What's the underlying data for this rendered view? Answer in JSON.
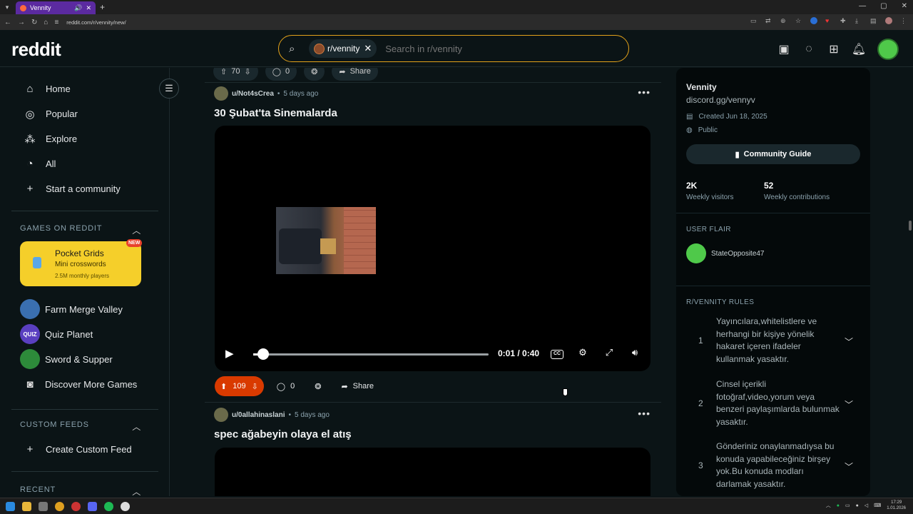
{
  "browser": {
    "tab_title": "Vennity",
    "url": "reddit.com/r/vennity/new/"
  },
  "header": {
    "logo": "reddit",
    "search_chip": "r/vennity",
    "search_placeholder": "Search in r/vennity"
  },
  "left_nav": {
    "items": [
      {
        "label": "Home",
        "icon": "home-icon"
      },
      {
        "label": "Popular",
        "icon": "popular-icon"
      },
      {
        "label": "Explore",
        "icon": "explore-icon"
      },
      {
        "label": "All",
        "icon": "all-icon"
      },
      {
        "label": "Start a community",
        "icon": "plus-icon"
      }
    ],
    "games_heading": "GAMES ON REDDIT",
    "promo": {
      "title": "Pocket Grids",
      "subtitle": "Mini crosswords",
      "meta": "2.5M monthly players",
      "badge": "NEW"
    },
    "games": [
      {
        "label": "Farm Merge Valley",
        "color": "#3a6fb0"
      },
      {
        "label": "Quiz Planet",
        "color": "#5a3fc0",
        "avatar_text": "QUIZ"
      },
      {
        "label": "Sword & Supper",
        "color": "#2d8a3a"
      },
      {
        "label": "Discover More Games"
      }
    ],
    "custom_feeds_heading": "CUSTOM FEEDS",
    "create_feed": "Create Custom Feed",
    "recent_heading": "RECENT"
  },
  "feed": {
    "prev_post": {
      "votes": "70",
      "comments": "0",
      "share": "Share"
    },
    "posts": [
      {
        "user": "u/Not4sCrea",
        "time": "5 days ago",
        "title": "30 Şubat'ta Sinemalarda",
        "video_time": "0:01 / 0:40",
        "progress": 0.025,
        "votes": "109",
        "comments": "0",
        "share": "Share"
      },
      {
        "user": "u/0allahinaslani",
        "time": "5 days ago",
        "title": "spec ağabeyin olaya el atış"
      }
    ]
  },
  "sidebar": {
    "community_name": "Vennity",
    "link": "discord.gg/vennyv",
    "created": "Created Jun 18, 2025",
    "visibility": "Public",
    "guide_button": "Community Guide",
    "stats": [
      {
        "value": "2K",
        "label": "Weekly visitors"
      },
      {
        "value": "52",
        "label": "Weekly contributions"
      }
    ],
    "flair_heading": "USER FLAIR",
    "flair_user": "StateOpposite47",
    "rules_heading": "R/VENNITY RULES",
    "rules": [
      {
        "num": "1",
        "text": "Yayıncılara,whitelistlere ve herhangi bir kişiye yönelik hakaret içeren ifadeler kullanmak yasaktır."
      },
      {
        "num": "2",
        "text": "Cinsel içerikli fotoğraf,video,yorum veya benzeri paylaşımlarda bulunmak yasaktır."
      },
      {
        "num": "3",
        "text": "Gönderiniz onaylanmadıysa bu konuda yapabileceğiniz birşey yok.Bu konuda modları darlamak yasaktır."
      }
    ]
  },
  "taskbar": {
    "time": "17:29",
    "date": "1.01.2026"
  },
  "colors": {
    "accent": "#d93a00",
    "search_border": "#e3a21a",
    "background": "#0b1416"
  }
}
